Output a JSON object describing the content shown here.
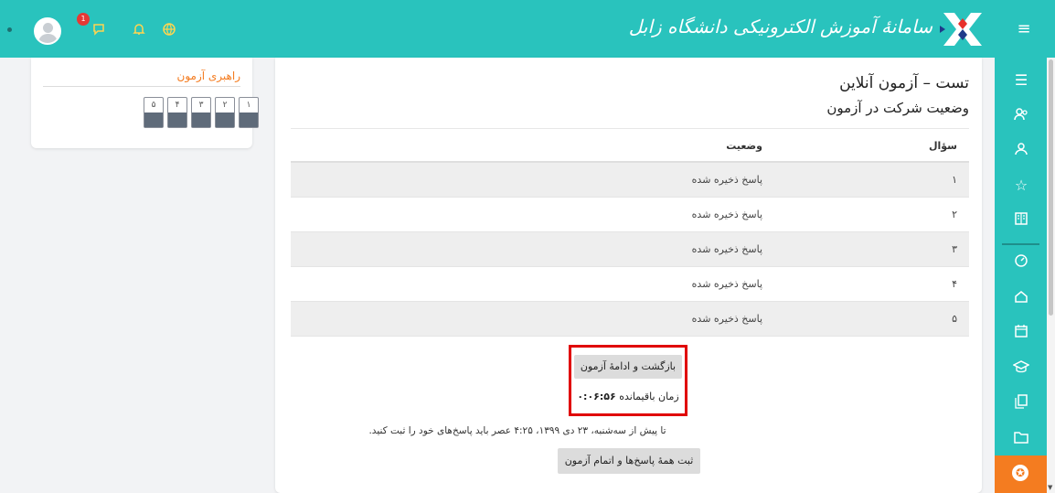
{
  "header": {
    "brand_title": "سامانهٔ آموزش الکترونیکی دانشگاه زابل",
    "notification_count": "1",
    "menu_icon": "hamburger-icon",
    "icons": [
      "avatar-icon",
      "chat-icon",
      "bell-icon",
      "globe-icon"
    ],
    "bar_color": "#29c3bd"
  },
  "quiz_nav": {
    "title": "راهبری آزمون",
    "questions": [
      "۱",
      "۲",
      "۳",
      "۴",
      "۵"
    ]
  },
  "main": {
    "title": "تست – آزمون آنلاین",
    "subtitle": "وضعیت شرکت در آزمون",
    "table": {
      "headers": {
        "question": "سؤال",
        "status": "وضعیت"
      },
      "rows": [
        {
          "question": "۱",
          "status": "پاسخ ذخیره شده"
        },
        {
          "question": "۲",
          "status": "پاسخ ذخیره شده"
        },
        {
          "question": "۳",
          "status": "پاسخ ذخیره شده"
        },
        {
          "question": "۴",
          "status": "پاسخ ذخیره شده"
        },
        {
          "question": "۵",
          "status": "پاسخ ذخیره شده"
        }
      ]
    },
    "return_button": "بازگشت و ادامهٔ آزمون",
    "time_left_label": "زمان باقیمانده",
    "time_left_value": "۰:۰۶:۵۶",
    "deadline_text": "تا پیش از سه‌شنبه، ۲۳ دی ۱۳۹۹، ۴:۲۵ عصر باید پاسخ‌های خود را ثبت کنید.",
    "submit_button": "ثبت همهٔ پاسخ‌ها و اتمام آزمون",
    "highlight_color": "#e00000"
  },
  "rail": {
    "icons": [
      "list-icon",
      "user-group-icon",
      "users-icon",
      "star-icon",
      "book-icon",
      "dashboard-icon",
      "home-icon",
      "calendar-icon",
      "graduation-cap-icon",
      "files-icon",
      "folder-icon",
      "accessibility-icon"
    ],
    "accent": "#f47c20"
  }
}
